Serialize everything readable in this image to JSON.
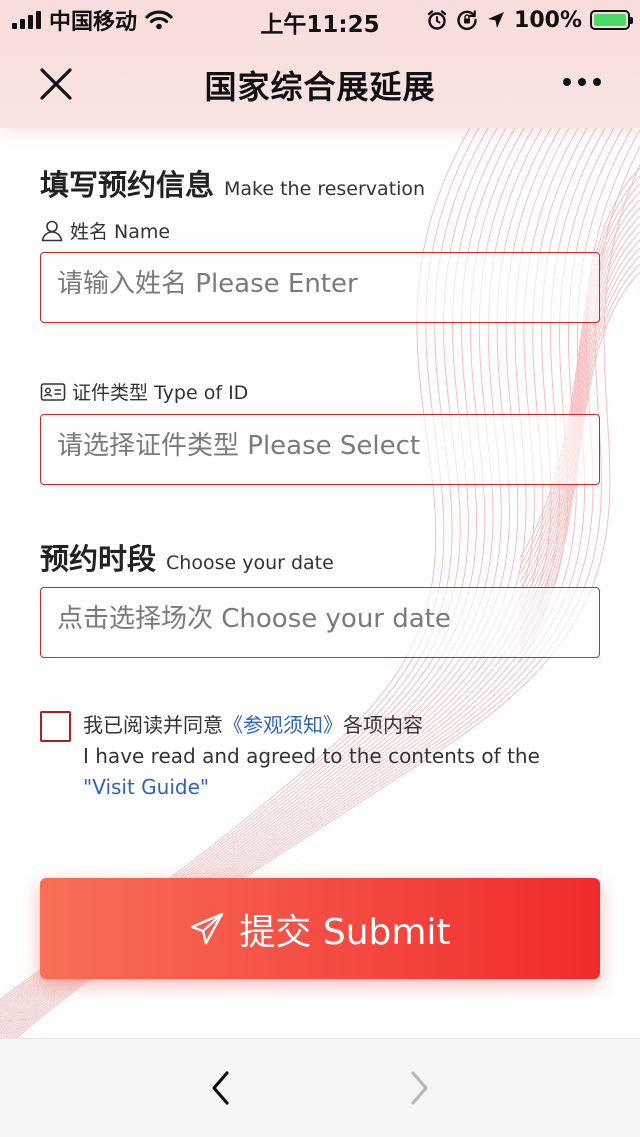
{
  "status_bar": {
    "carrier": "中国移动",
    "time": "上午11:25",
    "battery_percent": "100%",
    "battery_level": 1.0
  },
  "nav": {
    "title": "国家综合展延展"
  },
  "section_reservation": {
    "title_zh": "填写预约信息",
    "title_en": "Make the reservation"
  },
  "name_field": {
    "label": "姓名 Name",
    "placeholder": "请输入姓名 Please Enter"
  },
  "id_type_field": {
    "label": "证件类型 Type of ID",
    "placeholder": "请选择证件类型 Please Select"
  },
  "section_date": {
    "title_zh": "预约时段",
    "title_en": "Choose your date"
  },
  "date_field": {
    "placeholder": "点击选择场次 Choose your date"
  },
  "agreement": {
    "text_before": "我已阅读并同意",
    "link_zh": "《参观须知》",
    "text_after": "各项内容",
    "text_en": "I have read and agreed to the contents of the",
    "link_en": "\"Visit Guide\"",
    "checked": false
  },
  "submit": {
    "label": "提交 Submit"
  },
  "colors": {
    "accent": "#f0312d",
    "border": "#c42b2b",
    "link": "#2e63b8",
    "header_bg": "#f8dedd"
  }
}
